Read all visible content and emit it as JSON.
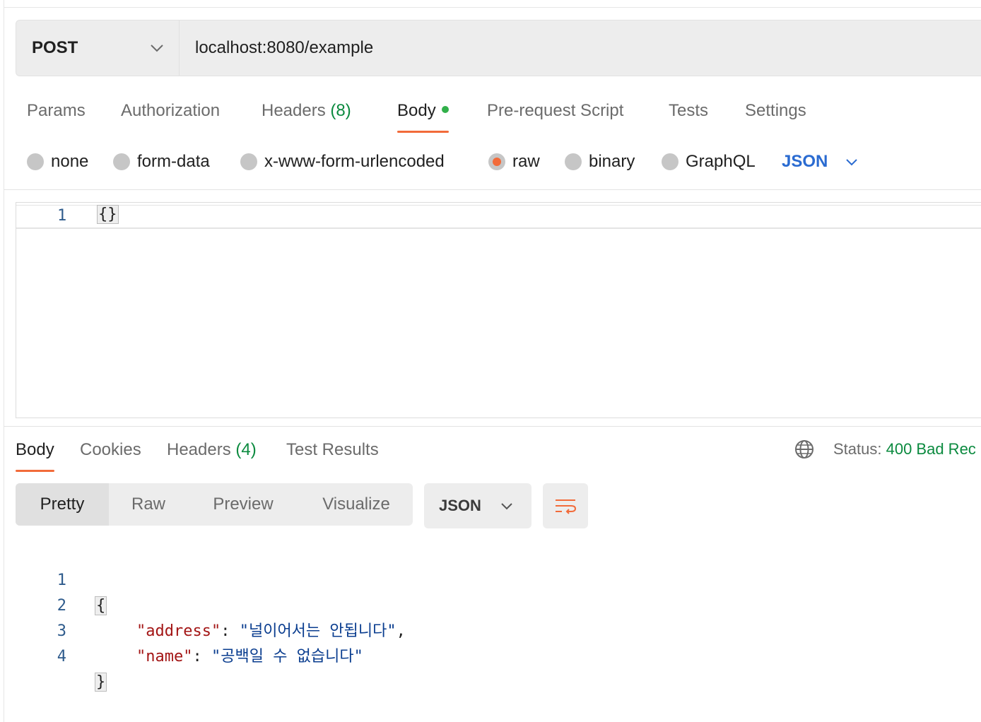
{
  "request": {
    "method": "POST",
    "url": "localhost:8080/example",
    "tabs": [
      {
        "label": "Params",
        "count": ""
      },
      {
        "label": "Authorization",
        "count": ""
      },
      {
        "label": "Headers",
        "count": "(8)"
      },
      {
        "label": "Body",
        "count": ""
      },
      {
        "label": "Pre-request Script",
        "count": ""
      },
      {
        "label": "Tests",
        "count": ""
      },
      {
        "label": "Settings",
        "count": ""
      }
    ],
    "active_tab": "Body",
    "body_modes": [
      "none",
      "form-data",
      "x-www-form-urlencoded",
      "raw",
      "binary",
      "GraphQL"
    ],
    "selected_mode": "raw",
    "raw_format": "JSON",
    "editor": {
      "line_number": "1",
      "content": "{}"
    }
  },
  "response": {
    "tabs": [
      {
        "label": "Body",
        "count": ""
      },
      {
        "label": "Cookies",
        "count": ""
      },
      {
        "label": "Headers",
        "count": "(4)"
      },
      {
        "label": "Test Results",
        "count": ""
      }
    ],
    "active_tab": "Body",
    "status_label": "Status:",
    "status_value": "400 Bad Rec",
    "views": [
      "Pretty",
      "Raw",
      "Preview",
      "Visualize"
    ],
    "active_view": "Pretty",
    "format": "JSON",
    "code": {
      "line_numbers": [
        "1",
        "2",
        "3",
        "4"
      ],
      "open_brace": "{",
      "close_brace": "}",
      "entries": [
        {
          "key": "\"address\"",
          "value": "\"널이어서는 안됩니다\"",
          "trail": ","
        },
        {
          "key": "\"name\"",
          "value": "\"공백일 수 없습니다\"",
          "trail": ""
        }
      ]
    }
  },
  "colors": {
    "accent": "#f26b3a",
    "json_blue": "#2a6bd1",
    "status_green": "#0b8a3f",
    "key_red": "#a31515"
  }
}
